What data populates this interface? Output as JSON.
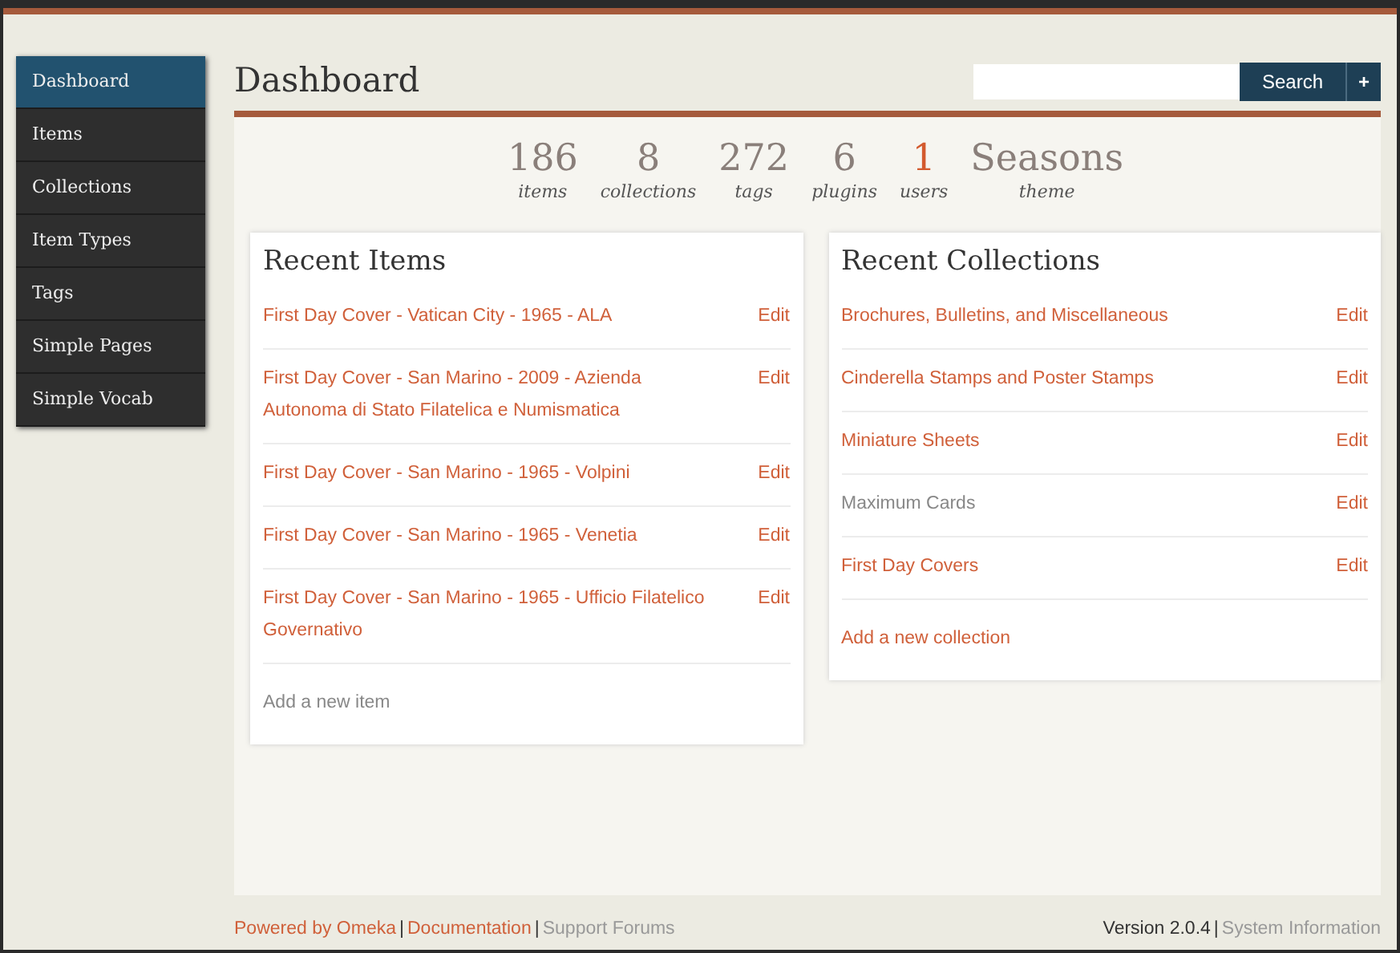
{
  "sidebar": {
    "items": [
      {
        "label": "Dashboard",
        "selected": true
      },
      {
        "label": "Items",
        "selected": false
      },
      {
        "label": "Collections",
        "selected": false
      },
      {
        "label": "Item Types",
        "selected": false
      },
      {
        "label": "Tags",
        "selected": false
      },
      {
        "label": "Simple Pages",
        "selected": false
      },
      {
        "label": "Simple Vocab",
        "selected": false
      }
    ]
  },
  "header": {
    "title": "Dashboard",
    "search": {
      "button": "Search",
      "add_button": "+"
    }
  },
  "stats": [
    {
      "value": "186",
      "label": "items",
      "highlight": false
    },
    {
      "value": "8",
      "label": "collections",
      "highlight": false
    },
    {
      "value": "272",
      "label": "tags",
      "highlight": false
    },
    {
      "value": "6",
      "label": "plugins",
      "highlight": false
    },
    {
      "value": "1",
      "label": "users",
      "highlight": true
    },
    {
      "value": "Seasons",
      "label": "theme",
      "highlight": false
    }
  ],
  "panels": [
    {
      "title": "Recent Items",
      "rows": [
        {
          "title": "First Day Cover - Vatican City - 1965 - ALA",
          "muted": false,
          "action": "Edit"
        },
        {
          "title": "First Day Cover - San Marino - 2009 - Azienda Autonoma di Stato Filatelica e Numismatica",
          "muted": false,
          "action": "Edit"
        },
        {
          "title": "First Day Cover - San Marino - 1965 - Volpini",
          "muted": false,
          "action": "Edit"
        },
        {
          "title": "First Day Cover - San Marino - 1965 - Venetia",
          "muted": false,
          "action": "Edit"
        },
        {
          "title": "First Day Cover - San Marino - 1965 - Ufficio Filatelico Governativo",
          "muted": false,
          "action": "Edit"
        }
      ],
      "add_link": {
        "label": "Add a new item",
        "muted": true
      }
    },
    {
      "title": "Recent Collections",
      "rows": [
        {
          "title": "Brochures, Bulletins, and Miscellaneous",
          "muted": false,
          "action": "Edit"
        },
        {
          "title": "Cinderella Stamps and Poster Stamps",
          "muted": false,
          "action": "Edit"
        },
        {
          "title": "Miniature Sheets",
          "muted": false,
          "action": "Edit"
        },
        {
          "title": "Maximum Cards",
          "muted": true,
          "action": "Edit"
        },
        {
          "title": "First Day Covers",
          "muted": false,
          "action": "Edit"
        }
      ],
      "add_link": {
        "label": "Add a new collection",
        "muted": false
      }
    }
  ],
  "footer": {
    "left": [
      {
        "label": "Powered by Omeka",
        "kind": "link"
      },
      {
        "label": "|",
        "kind": "separator"
      },
      {
        "label": "Documentation",
        "kind": "link"
      },
      {
        "label": "|",
        "kind": "separator"
      },
      {
        "label": "Support Forums",
        "kind": "muted"
      }
    ],
    "right": [
      {
        "label": "Version 2.0.4",
        "kind": "text"
      },
      {
        "label": "|",
        "kind": "separator"
      },
      {
        "label": "System Information",
        "kind": "muted"
      }
    ]
  }
}
